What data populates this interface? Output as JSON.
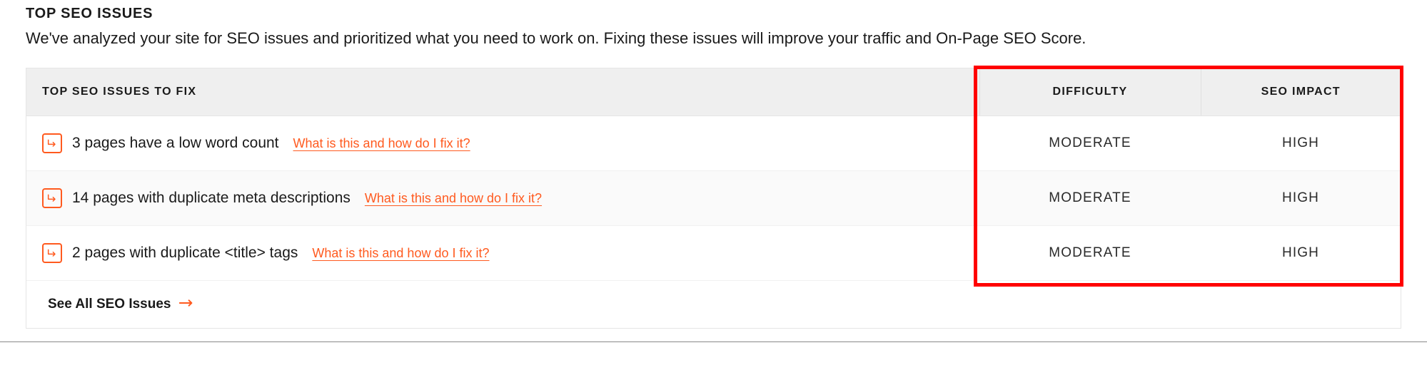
{
  "header": {
    "title": "TOP SEO ISSUES",
    "description": "We've analyzed your site for SEO issues and prioritized what you need to work on. Fixing these issues will improve your traffic and On-Page SEO Score."
  },
  "table": {
    "columns": {
      "issues": "TOP SEO ISSUES TO FIX",
      "difficulty": "DIFFICULTY",
      "impact": "SEO IMPACT"
    },
    "help_link_label": "What is this and how do I fix it?",
    "rows": [
      {
        "issue": "3 pages have a low word count",
        "difficulty": "MODERATE",
        "impact": "HIGH"
      },
      {
        "issue": "14 pages with duplicate meta descriptions",
        "difficulty": "MODERATE",
        "impact": "HIGH"
      },
      {
        "issue": "2 pages with duplicate <title> tags",
        "difficulty": "MODERATE",
        "impact": "HIGH"
      }
    ]
  },
  "footer": {
    "see_all_label": "See All SEO Issues"
  }
}
